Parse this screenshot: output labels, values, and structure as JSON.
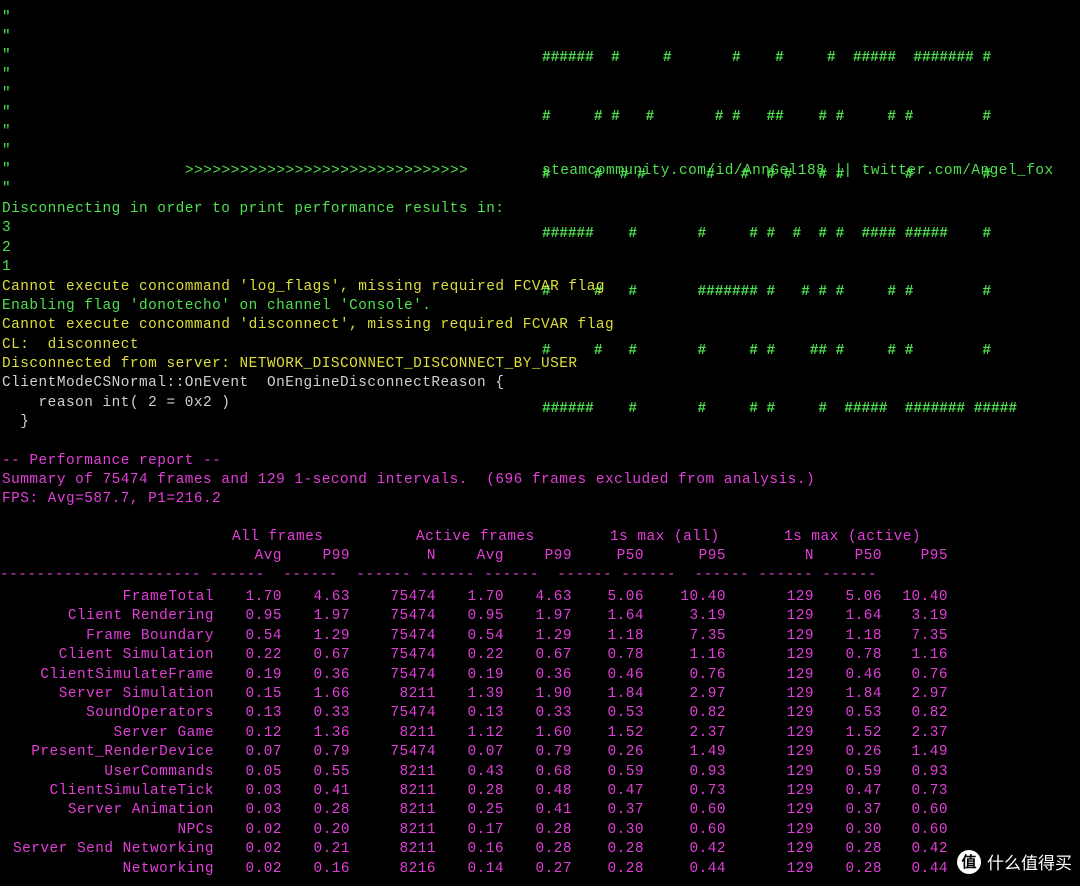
{
  "colors": {
    "background": "#000000",
    "green": "#4fe04f",
    "yellow": "#dede3c",
    "white": "#d0d0d0",
    "magenta": "#e23fd8"
  },
  "banner": {
    "quote_char": "\"",
    "art_lines": [
      "######  #     #       #    #     #  #####  ####### #",
      "#     # #   #       # #   ##    # #     # #        #",
      "#     #  # #       #   #  # #   # #       #        #",
      "######    #       #     # #  #  # #  #### #####    #",
      "#     #   #       ####### #   # # #     # #        #",
      "#     #   #       #     # #    ## #     # #        #",
      "######    #       #     # #     #  #####  ####### #####"
    ],
    "arrows": ">>>>>>>>>>>>>>>>>>>>>>>>>>>>>>>",
    "social": "steamcommunity.com/id/AnnGel188 || twitter.com/Angel_fox"
  },
  "log": [
    {
      "text": "Disconnecting in order to print performance results in:",
      "color": "green"
    },
    {
      "text": "3",
      "color": "green"
    },
    {
      "text": "2",
      "color": "green"
    },
    {
      "text": "1",
      "color": "green"
    },
    {
      "text": "Cannot execute concommand 'log_flags', missing required FCVAR flag",
      "color": "yellow"
    },
    {
      "text": "Enabling flag 'donotecho' on channel 'Console'.",
      "color": "green"
    },
    {
      "text": "Cannot execute concommand 'disconnect', missing required FCVAR flag",
      "color": "yellow"
    },
    {
      "text": "CL:  disconnect",
      "color": "yellow"
    },
    {
      "text": "Disconnected from server: NETWORK_DISCONNECT_DISCONNECT_BY_USER",
      "color": "yellow"
    },
    {
      "text": "ClientModeCSNormal::OnEvent  OnEngineDisconnectReason {",
      "color": "white"
    },
    {
      "text": "    reason int( 2 = 0x2 )",
      "color": "white"
    },
    {
      "text": "  }",
      "color": "white"
    },
    {
      "text": "",
      "color": "white"
    },
    {
      "text": "-- Performance report --",
      "color": "magenta"
    },
    {
      "text": "Summary of 75474 frames and 129 1-second intervals.  (696 frames excluded from analysis.)",
      "color": "magenta"
    },
    {
      "text": "FPS: Avg=587.7, P1=216.2",
      "color": "magenta"
    }
  ],
  "perf": {
    "groups": [
      "All frames",
      "Active frames",
      "1s max (all)",
      "1s max (active)"
    ],
    "columns": [
      "Avg",
      "P99",
      "N",
      "Avg",
      "P99",
      "P50",
      "P95",
      "N",
      "P50",
      "P95"
    ],
    "dashes": "---------------------- ------  ------  ------ ------ ------  ------ ------  ------ ------ ------",
    "rows": [
      {
        "name": "FrameTotal",
        "values": [
          "1.70",
          "4.63",
          "75474",
          "1.70",
          "4.63",
          "5.06",
          "10.40",
          "129",
          "5.06",
          "10.40"
        ]
      },
      {
        "name": "Client Rendering",
        "values": [
          "0.95",
          "1.97",
          "75474",
          "0.95",
          "1.97",
          "1.64",
          "3.19",
          "129",
          "1.64",
          "3.19"
        ]
      },
      {
        "name": "Frame Boundary",
        "values": [
          "0.54",
          "1.29",
          "75474",
          "0.54",
          "1.29",
          "1.18",
          "7.35",
          "129",
          "1.18",
          "7.35"
        ]
      },
      {
        "name": "Client Simulation",
        "values": [
          "0.22",
          "0.67",
          "75474",
          "0.22",
          "0.67",
          "0.78",
          "1.16",
          "129",
          "0.78",
          "1.16"
        ]
      },
      {
        "name": "ClientSimulateFrame",
        "values": [
          "0.19",
          "0.36",
          "75474",
          "0.19",
          "0.36",
          "0.46",
          "0.76",
          "129",
          "0.46",
          "0.76"
        ]
      },
      {
        "name": "Server Simulation",
        "values": [
          "0.15",
          "1.66",
          "8211",
          "1.39",
          "1.90",
          "1.84",
          "2.97",
          "129",
          "1.84",
          "2.97"
        ]
      },
      {
        "name": "SoundOperators",
        "values": [
          "0.13",
          "0.33",
          "75474",
          "0.13",
          "0.33",
          "0.53",
          "0.82",
          "129",
          "0.53",
          "0.82"
        ]
      },
      {
        "name": "Server Game",
        "values": [
          "0.12",
          "1.36",
          "8211",
          "1.12",
          "1.60",
          "1.52",
          "2.37",
          "129",
          "1.52",
          "2.37"
        ]
      },
      {
        "name": "Present_RenderDevice",
        "values": [
          "0.07",
          "0.79",
          "75474",
          "0.07",
          "0.79",
          "0.26",
          "1.49",
          "129",
          "0.26",
          "1.49"
        ]
      },
      {
        "name": "UserCommands",
        "values": [
          "0.05",
          "0.55",
          "8211",
          "0.43",
          "0.68",
          "0.59",
          "0.93",
          "129",
          "0.59",
          "0.93"
        ]
      },
      {
        "name": "ClientSimulateTick",
        "values": [
          "0.03",
          "0.41",
          "8211",
          "0.28",
          "0.48",
          "0.47",
          "0.73",
          "129",
          "0.47",
          "0.73"
        ]
      },
      {
        "name": "Server Animation",
        "values": [
          "0.03",
          "0.28",
          "8211",
          "0.25",
          "0.41",
          "0.37",
          "0.60",
          "129",
          "0.37",
          "0.60"
        ]
      },
      {
        "name": "NPCs",
        "values": [
          "0.02",
          "0.20",
          "8211",
          "0.17",
          "0.28",
          "0.30",
          "0.60",
          "129",
          "0.30",
          "0.60"
        ]
      },
      {
        "name": "Server Send Networking",
        "values": [
          "0.02",
          "0.21",
          "8211",
          "0.16",
          "0.28",
          "0.28",
          "0.42",
          "129",
          "0.28",
          "0.42"
        ]
      },
      {
        "name": "Networking",
        "values": [
          "0.02",
          "0.16",
          "8216",
          "0.14",
          "0.27",
          "0.28",
          "0.44",
          "129",
          "0.28",
          "0.44"
        ]
      }
    ]
  },
  "watermark": {
    "badge": "值",
    "text": "什么值得买"
  }
}
